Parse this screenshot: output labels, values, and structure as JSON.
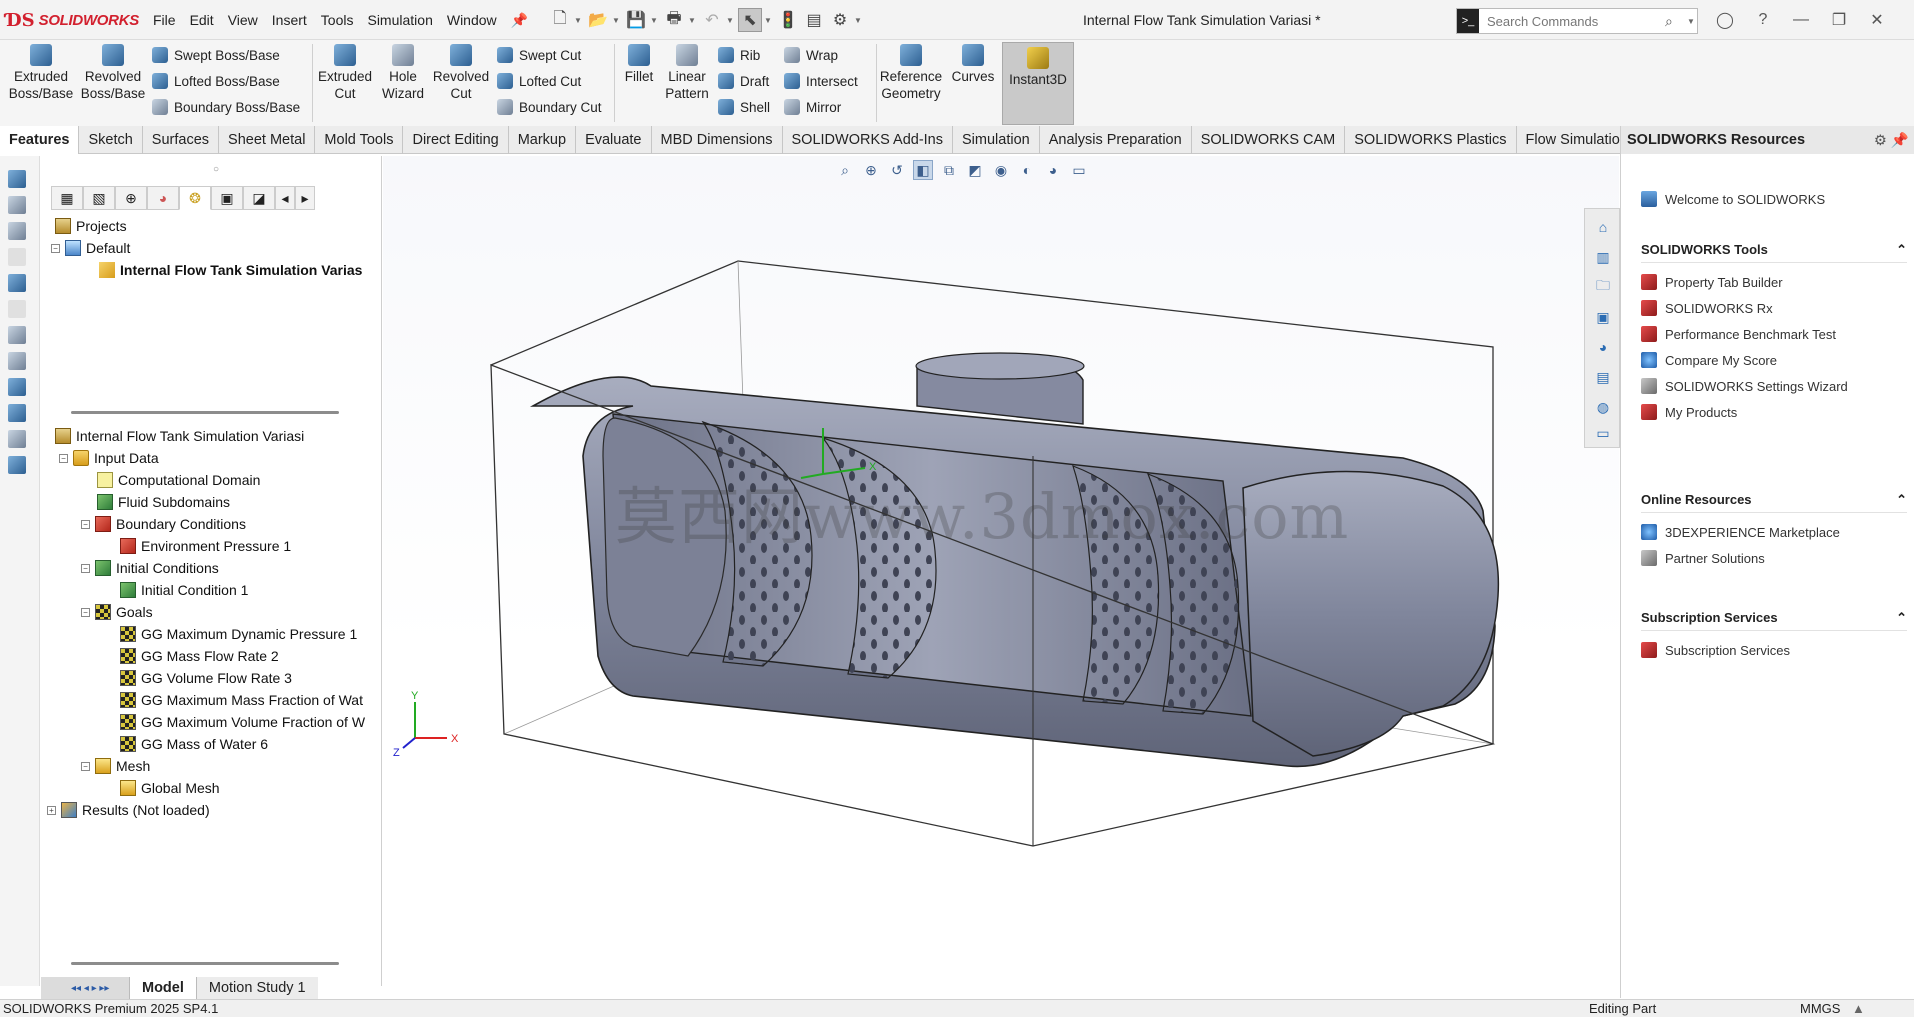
{
  "app": {
    "logo_text": "SOLIDWORKS",
    "document_title": "Internal Flow Tank Simulation Variasi *"
  },
  "menu": [
    "File",
    "Edit",
    "View",
    "Insert",
    "Tools",
    "Simulation",
    "Window"
  ],
  "search": {
    "placeholder": "Search Commands"
  },
  "ribbon": {
    "extruded_boss": "Extruded\nBoss/Base",
    "revolved_boss": "Revolved\nBoss/Base",
    "swept_boss": "Swept Boss/Base",
    "lofted_boss": "Lofted Boss/Base",
    "boundary_boss": "Boundary Boss/Base",
    "extruded_cut": "Extruded\nCut",
    "hole_wizard": "Hole\nWizard",
    "revolved_cut": "Revolved\nCut",
    "swept_cut": "Swept Cut",
    "lofted_cut": "Lofted Cut",
    "boundary_cut": "Boundary Cut",
    "fillet": "Fillet",
    "linear_pattern": "Linear\nPattern",
    "rib": "Rib",
    "draft": "Draft",
    "shell": "Shell",
    "wrap": "Wrap",
    "intersect": "Intersect",
    "mirror": "Mirror",
    "reference_geometry": "Reference\nGeometry",
    "curves": "Curves",
    "instant3d": "Instant3D"
  },
  "tabs": [
    "Features",
    "Sketch",
    "Surfaces",
    "Sheet Metal",
    "Mold Tools",
    "Direct Editing",
    "Markup",
    "Evaluate",
    "MBD Dimensions",
    "SOLIDWORKS Add-Ins",
    "Simulation",
    "Analysis Preparation",
    "SOLIDWORKS CAM",
    "SOLIDWORKS Plastics",
    "Flow Simulation"
  ],
  "projects_tree": {
    "root": "Projects",
    "config": "Default",
    "project": "Internal Flow Tank Simulation Varias"
  },
  "analysis_tree": {
    "root": "Internal Flow Tank Simulation Variasi",
    "input_data": "Input Data",
    "computational_domain": "Computational Domain",
    "fluid_subdomains": "Fluid Subdomains",
    "boundary_conditions": "Boundary Conditions",
    "environment_pressure": "Environment Pressure 1",
    "initial_conditions": "Initial Conditions",
    "initial_condition_1": "Initial Condition 1",
    "goals": "Goals",
    "goal_items": [
      "GG Maximum Dynamic Pressure 1",
      "GG Mass Flow Rate 2",
      "GG Volume Flow Rate 3",
      "GG Maximum Mass Fraction of Wat",
      "GG Maximum Volume Fraction of W",
      "GG Mass of Water 6"
    ],
    "mesh": "Mesh",
    "global_mesh": "Global Mesh",
    "results": "Results (Not loaded)"
  },
  "bottom_tabs": [
    "Model",
    "Motion Study 1"
  ],
  "status": {
    "left": "SOLIDWORKS Premium 2025 SP4.1",
    "mode": "Editing Part",
    "units": "MMGS"
  },
  "viewport": {
    "watermark": "莫西网www.3dmox.com",
    "axis_x": "X",
    "axis_y": "Y",
    "axis_z": "Z"
  },
  "resources": {
    "header": "SOLIDWORKS Resources",
    "welcome": "Welcome to SOLIDWORKS",
    "tools_title": "SOLIDWORKS Tools",
    "tools": [
      "Property Tab Builder",
      "SOLIDWORKS Rx",
      "Performance Benchmark Test",
      "Compare My Score",
      "SOLIDWORKS Settings Wizard",
      "My Products"
    ],
    "online_title": "Online Resources",
    "online": [
      "3DEXPERIENCE Marketplace",
      "Partner Solutions"
    ],
    "subscription_title": "Subscription Services",
    "subscription": [
      "Subscription Services"
    ]
  },
  "colors": {
    "brand_red": "#d2202e",
    "tank_body": "#8a90a6",
    "tank_dark": "#5d6276",
    "accent_blue": "#2b6cb3"
  }
}
